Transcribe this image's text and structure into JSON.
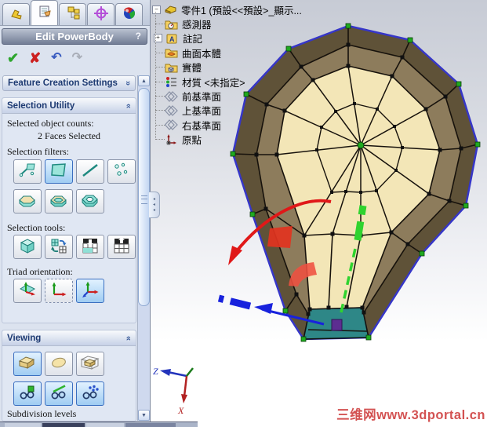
{
  "panel": {
    "title": "Edit PowerBody",
    "help_label": "?",
    "actions": {
      "ok": "✔",
      "cancel": "✘",
      "undo": "↶",
      "redo": "↷"
    },
    "sections": {
      "feature_creation": {
        "label": "Feature Creation Settings"
      },
      "selection_utility": {
        "label": "Selection Utility",
        "counts_label": "Selected object counts:",
        "counts_value": "2 Faces Selected",
        "filters_label": "Selection filters:",
        "tools_label": "Selection tools:",
        "triad_label": "Triad orientation:"
      },
      "viewing": {
        "label": "Viewing",
        "subdivision_label": "Subdivision levels"
      }
    }
  },
  "tree": {
    "root_label": "零件1 (預設<<預設>_顯示...",
    "items": [
      {
        "label": "感測器",
        "icon": "sensor-icon"
      },
      {
        "label": "註記",
        "icon": "annotation-icon"
      },
      {
        "label": "曲面本體",
        "icon": "surface-bodies-icon"
      },
      {
        "label": "實體",
        "icon": "solid-bodies-icon"
      },
      {
        "label": "材質 <未指定>",
        "icon": "material-icon"
      },
      {
        "label": "前基準面",
        "icon": "plane-icon"
      },
      {
        "label": "上基準面",
        "icon": "plane-icon"
      },
      {
        "label": "右基準面",
        "icon": "plane-icon"
      },
      {
        "label": "原點",
        "icon": "origin-icon"
      }
    ]
  },
  "viewport": {
    "axis": {
      "z": "Z",
      "x": "X"
    },
    "watermark": "三维网www.3dportal.cn",
    "colors": {
      "face_cream": "#f3e6b7",
      "face_mid_brown": "#8d7c5c",
      "face_dark_brown": "#5f5238",
      "face_teal": "#2e8787",
      "boundary_blue": "#3636c8",
      "vertex_green": "#1faa1f",
      "selected_vertex_purple": "#5c2d91",
      "manipulator_red": "#e01818",
      "manipulator_green": "#2fd32f",
      "manipulator_blue": "#1822dd"
    }
  }
}
